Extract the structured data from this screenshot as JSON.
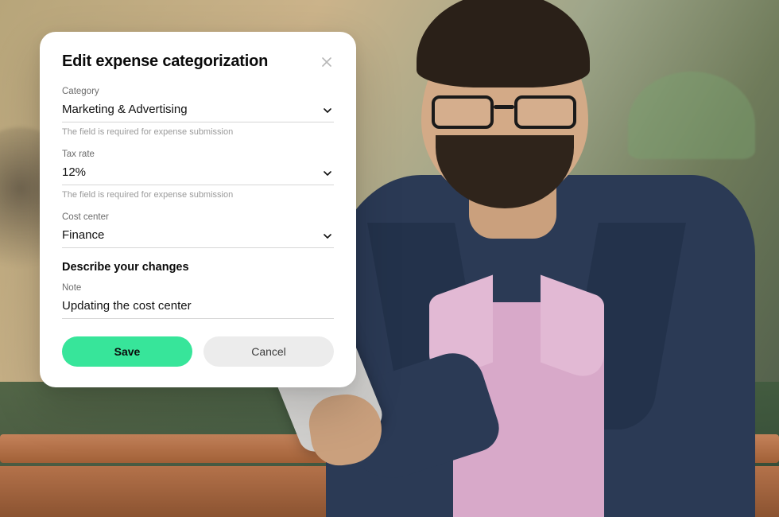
{
  "modal": {
    "title": "Edit expense categorization",
    "fields": {
      "category": {
        "label": "Category",
        "value": "Marketing & Advertising",
        "helper": "The field is required for expense submission"
      },
      "tax_rate": {
        "label": "Tax rate",
        "value": "12%",
        "helper": "The field is required for expense submission"
      },
      "cost_center": {
        "label": "Cost center",
        "value": "Finance"
      }
    },
    "section_title": "Describe your changes",
    "note": {
      "label": "Note",
      "value": "Updating the cost center"
    },
    "actions": {
      "save": "Save",
      "cancel": "Cancel"
    }
  },
  "colors": {
    "primary": "#37e59a",
    "secondary": "#ececec"
  }
}
